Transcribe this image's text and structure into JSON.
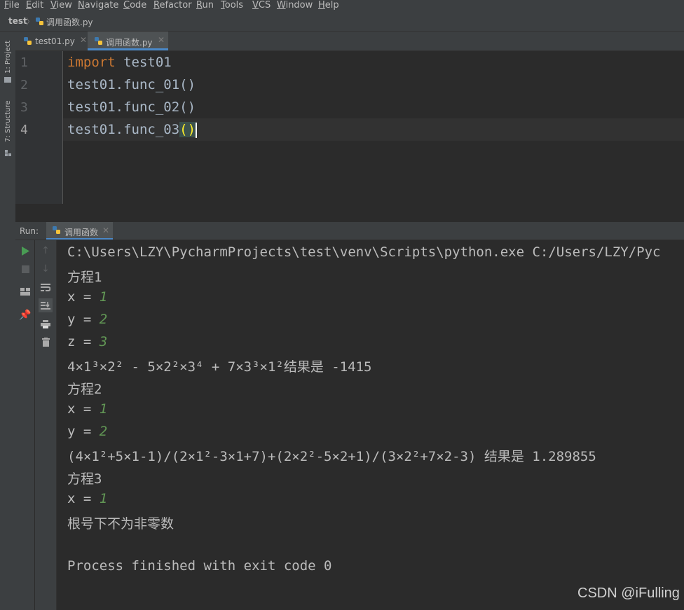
{
  "menu": [
    "File",
    "Edit",
    "View",
    "Navigate",
    "Code",
    "Refactor",
    "Run",
    "Tools",
    "VCS",
    "Window",
    "Help"
  ],
  "breadcrumb": {
    "project": "test",
    "file": "调用函数.py"
  },
  "left_tabs": {
    "project": "1: Project",
    "structure": "7: Structure"
  },
  "editor_tabs": [
    {
      "label": "test01.py",
      "active": false
    },
    {
      "label": "调用函数.py",
      "active": true
    }
  ],
  "code": {
    "line_numbers": [
      "1",
      "2",
      "3",
      "4"
    ],
    "line1_kw": "import",
    "line1_rest": " test01",
    "line2": "test01.func_01()",
    "line3": "test01.func_02()",
    "line4_pre": "test01.func_03",
    "line4_parens": "()"
  },
  "run": {
    "label": "Run:",
    "tab": "调用函数"
  },
  "console": {
    "cmd": "C:\\Users\\LZY\\PycharmProjects\\test\\venv\\Scripts\\python.exe C:/Users/LZY/Pyc",
    "l1": "方程1",
    "l2_pre": "x = ",
    "l2_val": "1",
    "l3_pre": "y = ",
    "l3_val": "2",
    "l4_pre": "z = ",
    "l4_val": "3",
    "l5": "4×1³×2² - 5×2²×3⁴ + 7×3³×1²结果是 -1415",
    "l6": "方程2",
    "l7_pre": "x = ",
    "l7_val": "1",
    "l8_pre": "y = ",
    "l8_val": "2",
    "l9": "(4×1²+5×1-1)/(2×1²-3×1+7)+(2×2²-5×2+1)/(3×2²+7×2-3) 结果是 1.289855",
    "l10": "方程3",
    "l11_pre": "x = ",
    "l11_val": "1",
    "l12": "根号下不为非零数",
    "l13": "",
    "l14": "Process finished with exit code 0"
  },
  "watermark": "CSDN @iFulling",
  "colors": {
    "keyword": "#cc7832",
    "input": "#629755",
    "accent": "#4a88c7",
    "run_green": "#499c54"
  }
}
